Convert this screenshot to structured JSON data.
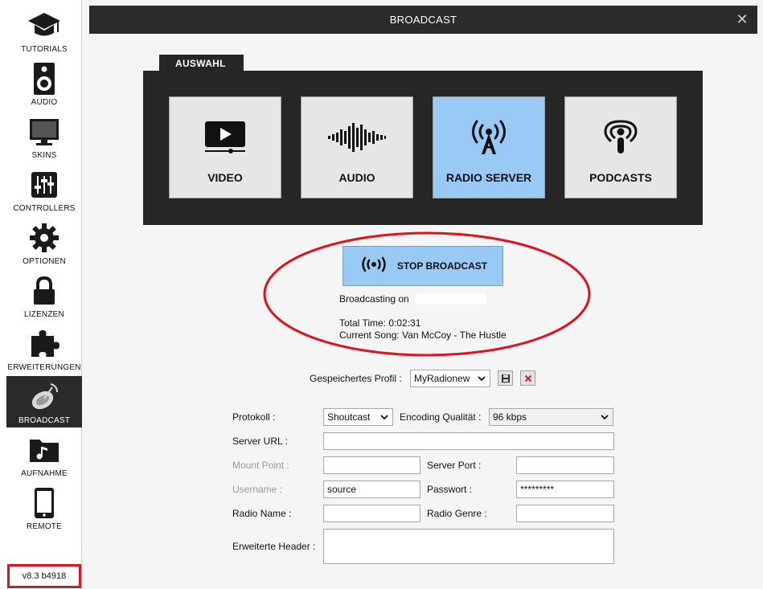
{
  "sidebar": {
    "items": [
      {
        "label": "TUTORIALS",
        "icon": "graduation-cap-icon"
      },
      {
        "label": "AUDIO",
        "icon": "speaker-icon"
      },
      {
        "label": "SKINS",
        "icon": "monitor-icon"
      },
      {
        "label": "CONTROLLERS",
        "icon": "sliders-icon"
      },
      {
        "label": "OPTIONEN",
        "icon": "gear-icon"
      },
      {
        "label": "LIZENZEN",
        "icon": "lock-icon"
      },
      {
        "label": "ERWEITERUNGEN",
        "icon": "puzzle-icon"
      },
      {
        "label": "BROADCAST",
        "icon": "broadcast-dish-icon",
        "active": true
      },
      {
        "label": "AUFNAHME",
        "icon": "music-folder-icon"
      },
      {
        "label": "REMOTE",
        "icon": "phone-icon"
      }
    ],
    "version": "v8.3 b4918"
  },
  "window": {
    "title": "BROADCAST",
    "close_icon": "close-icon"
  },
  "selection": {
    "tab_label": "AUSWAHL",
    "options": [
      {
        "label": "VIDEO",
        "icon": "video-play-icon"
      },
      {
        "label": "AUDIO",
        "icon": "waveform-icon"
      },
      {
        "label": "RADIO SERVER",
        "icon": "radio-tower-icon",
        "active": true
      },
      {
        "label": "PODCASTS",
        "icon": "podcast-icon"
      }
    ]
  },
  "status": {
    "stop_label": "STOP BROADCAST",
    "broadcasting_on": "Broadcasting on",
    "total_time": "Total Time: 0:02:31",
    "current_song": "Current Song: Van McCoy - The Hustle"
  },
  "profile": {
    "label": "Gespeichertes Profil :",
    "selected": "MyRadionew",
    "save_icon": "save-icon",
    "delete_icon": "delete-icon"
  },
  "form": {
    "protokoll_label": "Protokoll :",
    "protokoll_value": "Shoutcast",
    "encoding_label": "Encoding Qualität :",
    "encoding_value": "96 kbps",
    "server_url_label": "Server URL :",
    "server_url_value": "",
    "mount_point_label": "Mount Point :",
    "mount_point_value": "",
    "server_port_label": "Server Port :",
    "server_port_value": "",
    "username_label": "Username :",
    "username_value": "source",
    "password_label": "Passwort :",
    "password_value": "*********",
    "radio_name_label": "Radio Name :",
    "radio_name_value": "",
    "radio_genre_label": "Radio Genre :",
    "radio_genre_value": "",
    "headers_label": "Erweiterte Header :",
    "headers_value": ""
  },
  "colors": {
    "active_blue": "#99c9f5",
    "panel_dark": "#262626",
    "annotation_red": "#e0121b"
  }
}
